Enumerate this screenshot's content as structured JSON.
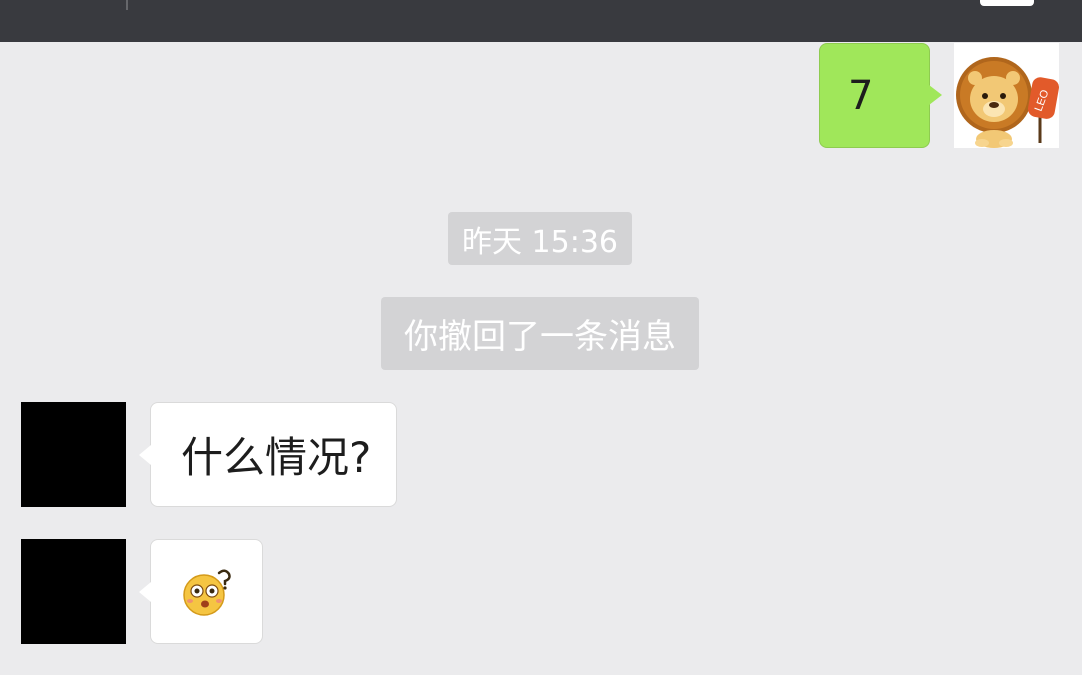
{
  "messages": {
    "outgoing_text": "7",
    "timestamp": "昨天 15:36",
    "recall_notice": "你撤回了一条消息",
    "incoming_text": "什么情况?"
  },
  "icons": {
    "lion_avatar": "lion-leo-avatar",
    "emoji": "confused-face-emoji"
  }
}
